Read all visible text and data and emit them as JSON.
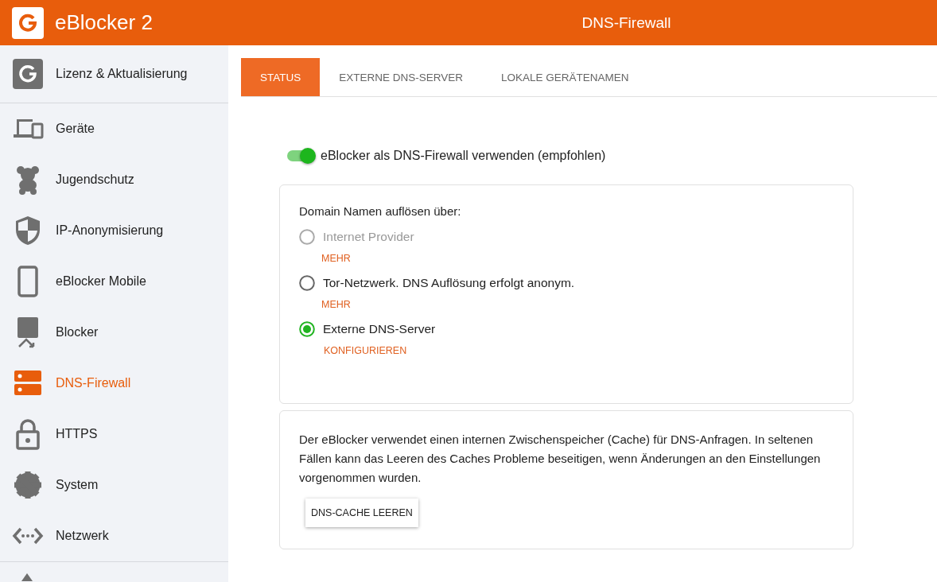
{
  "header": {
    "logo_text": "eBlocker 2",
    "page_title": "DNS-Firewall"
  },
  "sidebar": {
    "items": [
      {
        "label": "Lizenz & Aktualisierung",
        "selected": false
      },
      {
        "label": "Geräte",
        "selected": false
      },
      {
        "label": "Jugendschutz",
        "selected": false
      },
      {
        "label": "IP-Anonymisierung",
        "selected": false
      },
      {
        "label": "eBlocker Mobile",
        "selected": false
      },
      {
        "label": "Blocker",
        "selected": false
      },
      {
        "label": "DNS-Firewall",
        "selected": true
      },
      {
        "label": "HTTPS",
        "selected": false
      },
      {
        "label": "System",
        "selected": false
      },
      {
        "label": "Netzwerk",
        "selected": false
      }
    ]
  },
  "tabs": [
    {
      "label": "STATUS",
      "selected": true
    },
    {
      "label": "EXTERNE DNS-SERVER",
      "selected": false
    },
    {
      "label": "LOKALE GERÄTENAMEN",
      "selected": false
    }
  ],
  "firewall_toggle": {
    "label": "eBlocker als DNS-Firewall verwenden (empfohlen)",
    "on": true
  },
  "resolver_card": {
    "heading": "Domain Namen auflösen über:",
    "options": [
      {
        "label": "Internet Provider",
        "selected": false,
        "disabled": true,
        "link": "MEHR"
      },
      {
        "label": "Tor-Netzwerk. DNS Auflösung erfolgt anonym.",
        "selected": false,
        "disabled": false,
        "link": "MEHR"
      },
      {
        "label": "Externe DNS-Server",
        "selected": true,
        "disabled": false,
        "link": "KONFIGURIEREN"
      }
    ]
  },
  "cache_card": {
    "text": "Der eBlocker verwendet einen internen Zwischenspeicher (Cache) für DNS-Anfragen. In seltenen Fällen kann das Leeren des Caches Probleme beseitigen, wenn Änderungen an den Einstellungen vorgenommen wurden.",
    "button": "DNS-CACHE LEEREN"
  }
}
